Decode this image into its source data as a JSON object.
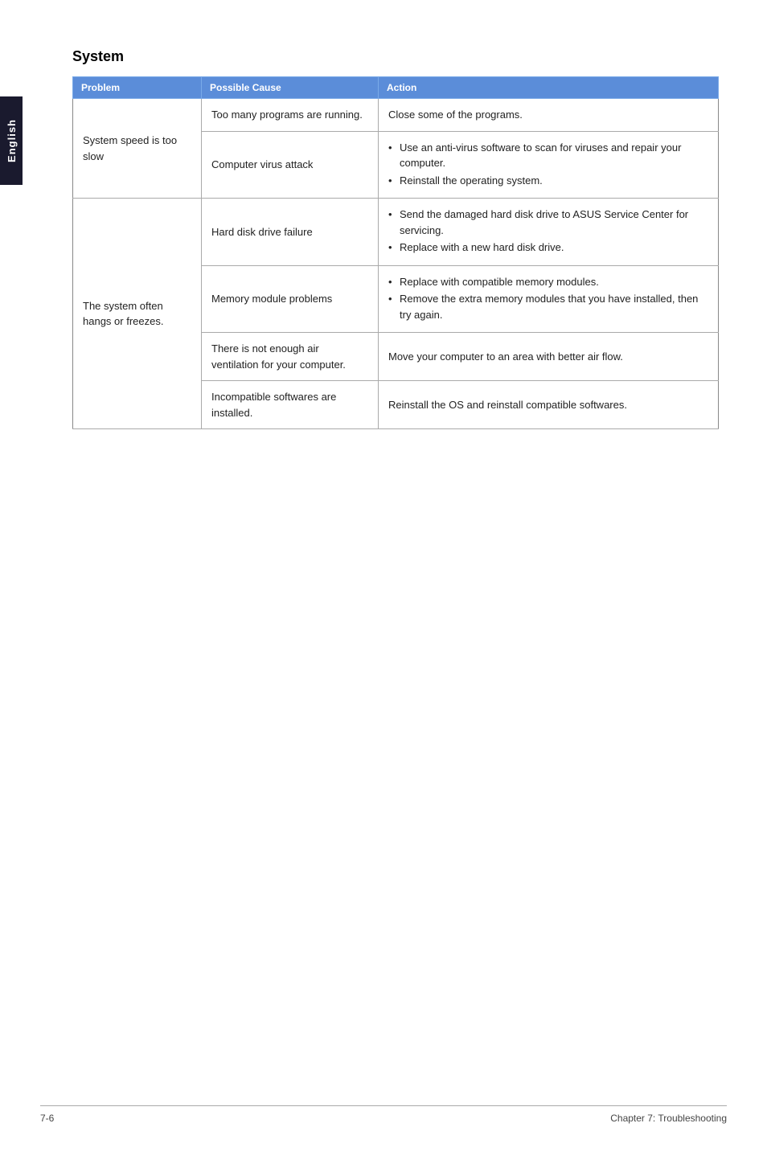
{
  "page": {
    "title": "System",
    "sidebar_label": "English",
    "footer_left": "7-6",
    "footer_right": "Chapter 7: Troubleshooting"
  },
  "table": {
    "headers": {
      "problem": "Problem",
      "cause": "Possible Cause",
      "action": "Action"
    },
    "rows": [
      {
        "problem": "System speed is too slow",
        "causes": [
          {
            "cause": "Too many programs are running.",
            "action_type": "text",
            "action": "Close some of the programs."
          },
          {
            "cause": "Computer virus attack",
            "action_type": "bullets",
            "action": [
              "Use an anti-virus software to scan for viruses and repair your computer.",
              "Reinstall the operating system."
            ]
          }
        ]
      },
      {
        "problem": "The system often hangs or freezes.",
        "causes": [
          {
            "cause": "Hard disk drive failure",
            "action_type": "bullets",
            "action": [
              "Send the damaged hard disk drive to ASUS Service Center for servicing.",
              "Replace with a new hard disk drive."
            ]
          },
          {
            "cause": "Memory module problems",
            "action_type": "bullets",
            "action": [
              "Replace with compatible memory modules.",
              "Remove the extra memory modules that you have installed, then try again."
            ]
          },
          {
            "cause": "There is not enough air ventilation for your computer.",
            "action_type": "text",
            "action": "Move your computer to an area with better air flow."
          },
          {
            "cause": "Incompatible softwares are installed.",
            "action_type": "text",
            "action": "Reinstall the OS and reinstall compatible softwares."
          }
        ]
      }
    ]
  }
}
